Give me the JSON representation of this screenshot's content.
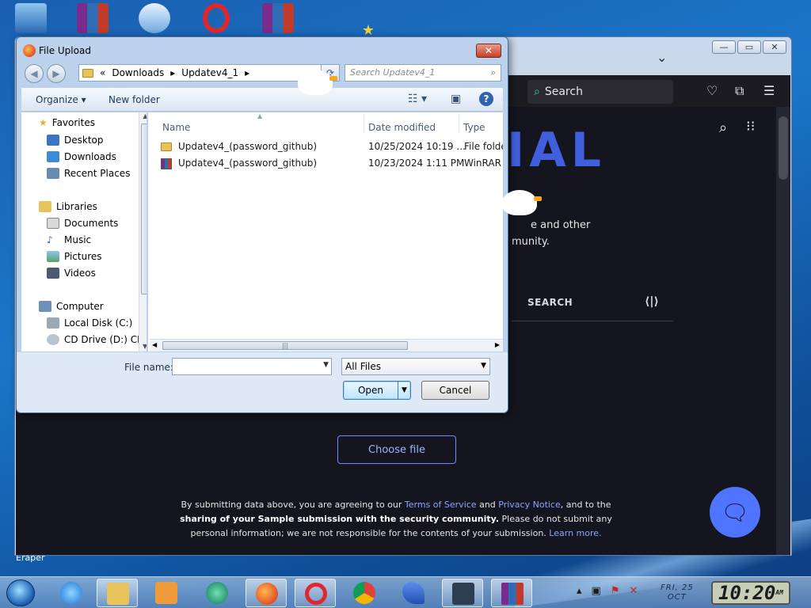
{
  "dialog": {
    "title": "File Upload",
    "breadcrumb": [
      "«",
      "Downloads",
      "Updatev4_1"
    ],
    "search_placeholder": "Search Updatev4_1",
    "organize_label": "Organize ▾",
    "new_folder_label": "New folder",
    "nav": {
      "favorites": "Favorites",
      "desktop": "Desktop",
      "downloads": "Downloads",
      "recent": "Recent Places",
      "libraries": "Libraries",
      "documents": "Documents",
      "music": "Music",
      "pictures": "Pictures",
      "videos": "Videos",
      "computer": "Computer",
      "local_disk": "Local Disk (C:)",
      "cd_drive": "CD Drive (D:) CDI"
    },
    "columns": {
      "name": "Name",
      "date": "Date modified",
      "type": "Type"
    },
    "files": [
      {
        "name": "Updatev4_(password_github)",
        "date": "10/25/2024 10:19 ...",
        "type": "File folder"
      },
      {
        "name": "Updatev4_(password_github)",
        "date": "10/23/2024 1:11 PM",
        "type": "WinRAR Z"
      }
    ],
    "file_name_label": "File name:",
    "file_name_value": "",
    "filter_value": "All Files",
    "open_label": "Open",
    "cancel_label": "Cancel"
  },
  "browser": {
    "search_label": "Search",
    "page_text_1": "e and other",
    "page_text_2": "munity.",
    "search_tab": "SEARCH",
    "choose_file": "Choose file",
    "disclaimer": {
      "p1": "By submitting data above, you are agreeing to our",
      "terms": "Terms of Service",
      "and": "and",
      "privacy": "Privacy Notice",
      "p2": ", and to the",
      "bold": "sharing of your Sample submission with the security community.",
      "p3": "Please do not submit any personal information; we are not responsible for the contents of your submission.",
      "learn": "Learn more."
    }
  },
  "taskbar": {
    "date_day": "FRI, 25",
    "date_month": "OCT",
    "time": "10:20",
    "ampm": "AM"
  },
  "desktop": {
    "label_fragment": "Eraper"
  },
  "colors": {
    "accent": "#4f74ff",
    "page_bg": "#14151f",
    "dialog_bg": "#bcd2ec"
  }
}
